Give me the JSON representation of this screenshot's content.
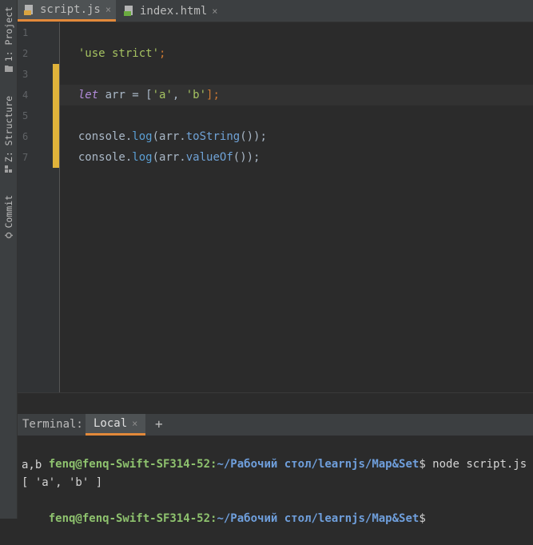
{
  "left_strip": {
    "items": [
      {
        "label": "1: Project",
        "icon": "folder-icon"
      },
      {
        "label": "Z: Structure",
        "icon": "structure-icon"
      },
      {
        "label": "Commit",
        "icon": "commit-icon"
      }
    ]
  },
  "tabs": [
    {
      "label": "script.js",
      "active": true,
      "icon": "js-file-icon"
    },
    {
      "label": "index.html",
      "active": false,
      "icon": "html-file-icon"
    }
  ],
  "tab_close_glyph": "×",
  "editor": {
    "line_numbers": [
      "1",
      "2",
      "3",
      "4",
      "5",
      "6",
      "7"
    ],
    "lines": {
      "l1": {
        "str": "'use strict'",
        "end": ";"
      },
      "l3": {
        "kw": "let",
        "name": " arr = [",
        "s1": "'a'",
        "comma": ", ",
        "s2": "'b'",
        "end": "];"
      },
      "l5": {
        "obj": "console.",
        "fn": "log",
        "open": "(arr.",
        "method": "toString",
        "close": "());"
      },
      "l6": {
        "obj": "console.",
        "fn": "log",
        "open": "(arr.",
        "method": "valueOf",
        "close": "());"
      }
    }
  },
  "terminal": {
    "title": "Terminal:",
    "tab": "Local",
    "add": "+",
    "lines": [
      {
        "user": "fenq@fenq-Swift-SF314-52",
        "sep": ":",
        "path": "~/Рабочий стол/learnjs/Map&Set",
        "cmd": "$ node script.js"
      },
      {
        "text": "a,b"
      },
      {
        "text": "[ 'a', 'b' ]"
      },
      {
        "user": "fenq@fenq-Swift-SF314-52",
        "sep": ":",
        "path": "~/Рабочий стол/learnjs/Map&Set",
        "cmd": "$"
      }
    ]
  },
  "colors": {
    "accent": "#e2893a",
    "change_marker": "#e0b33a",
    "string": "#a5c261",
    "keyword": "#cc7832"
  }
}
